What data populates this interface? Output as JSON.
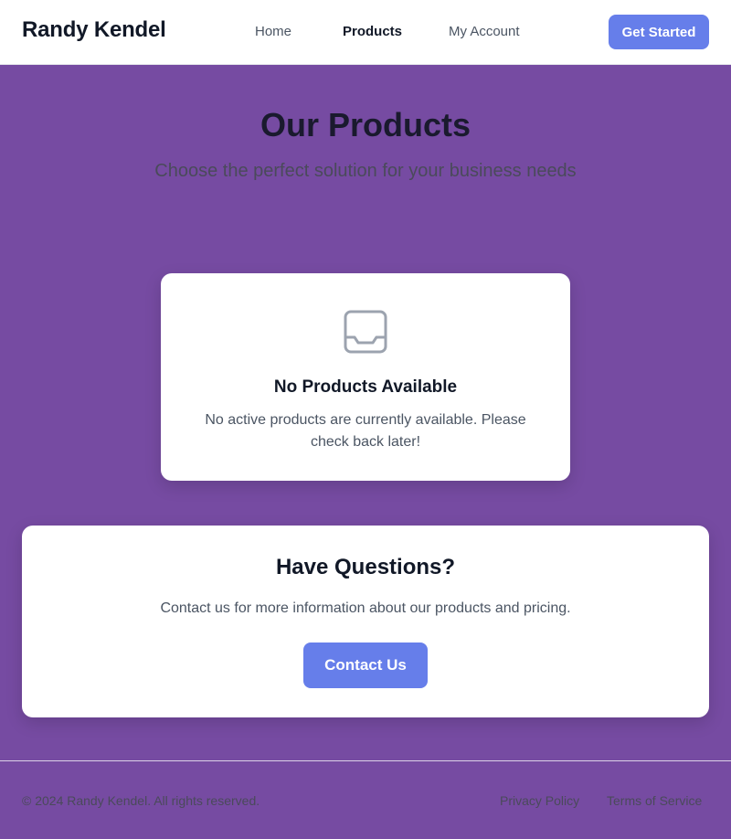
{
  "header": {
    "brand": "Randy Kendel",
    "nav": [
      {
        "label": "Home",
        "active": false
      },
      {
        "label": "Products",
        "active": true
      },
      {
        "label": "My Account",
        "active": false
      }
    ],
    "cta_label": "Get Started"
  },
  "hero": {
    "title": "Our Products",
    "subtitle": "Choose the perfect solution for your business needs"
  },
  "empty_state": {
    "icon": "inbox-icon",
    "title": "No Products Available",
    "text": "No active products are currently available. Please check back later!"
  },
  "questions": {
    "title": "Have Questions?",
    "text": "Contact us for more information about our products and pricing.",
    "button_label": "Contact Us"
  },
  "footer": {
    "copyright": "© 2024 Randy Kendel. All rights reserved.",
    "links": [
      {
        "label": "Privacy Policy"
      },
      {
        "label": "Terms of Service"
      }
    ]
  },
  "colors": {
    "background": "#764ba2",
    "accent": "#667eea",
    "card": "#ffffff",
    "heading": "#1a1a2e"
  }
}
